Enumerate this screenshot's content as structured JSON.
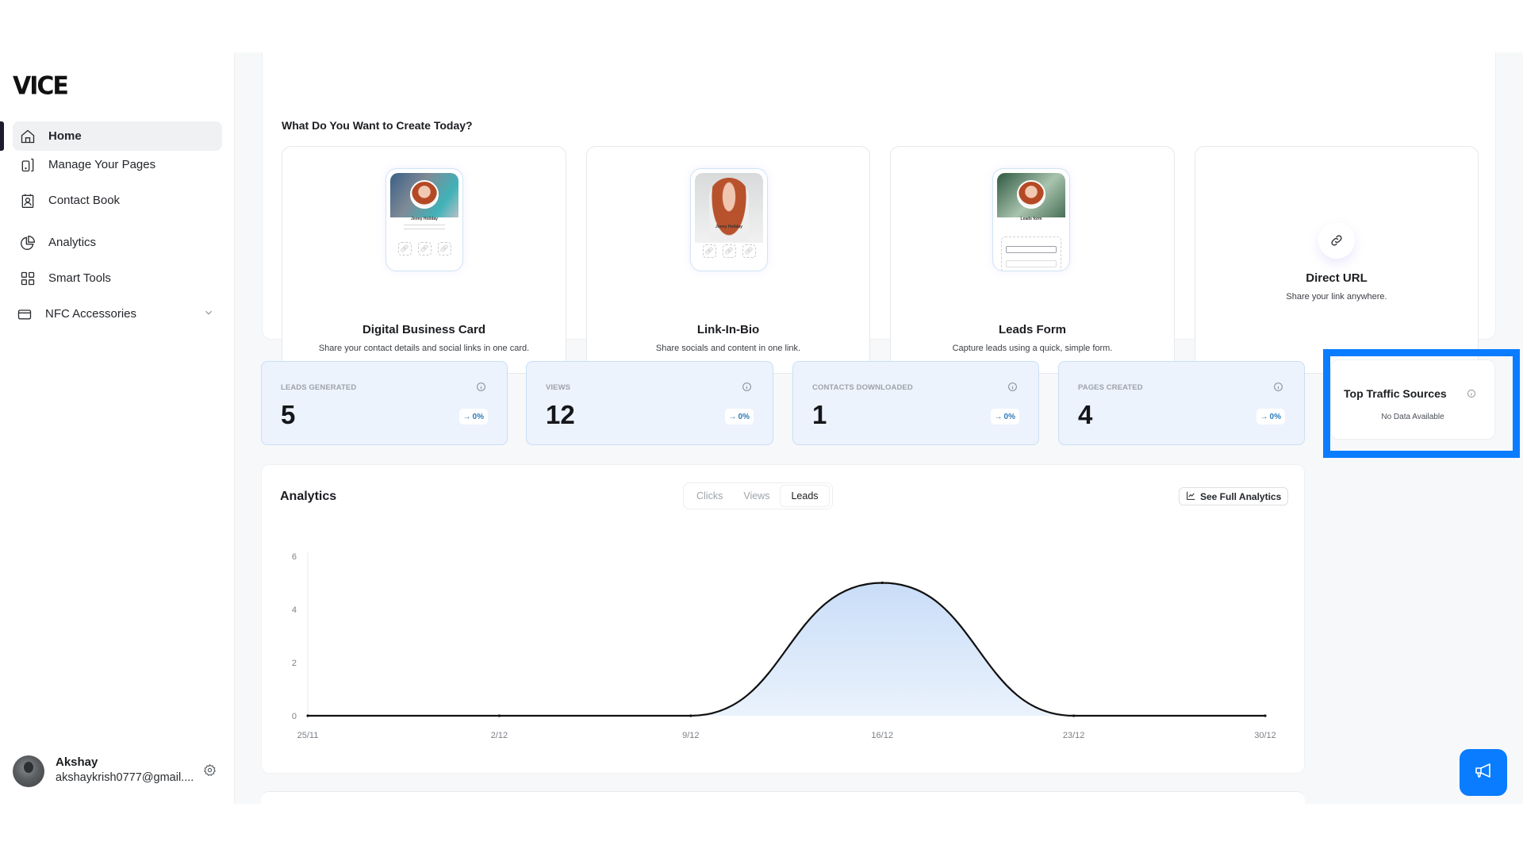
{
  "app": {
    "logo": "VICE"
  },
  "sidebar": {
    "items": [
      {
        "label": "Home",
        "icon": "home-icon",
        "active": true
      },
      {
        "label": "Manage Your Pages",
        "icon": "pages-icon"
      },
      {
        "label": "Contact Book",
        "icon": "contact-book-icon"
      },
      {
        "label": "Analytics",
        "icon": "pie-chart-icon"
      },
      {
        "label": "Smart Tools",
        "icon": "grid-icon"
      },
      {
        "label": "NFC Accessories",
        "icon": "card-icon",
        "expandable": true
      }
    ],
    "profile": {
      "name": "Akshay",
      "email": "akshaykrish0777@gmail...."
    }
  },
  "create": {
    "title": "What Do You Want to Create Today?",
    "cards": [
      {
        "title": "Digital Business Card",
        "desc": "Share your contact details and social links in one card.",
        "preview_name": "Jenny Holiday"
      },
      {
        "title": "Link-In-Bio",
        "desc": "Share socials and content in one link.",
        "preview_name": "Jenny Holiday"
      },
      {
        "title": "Leads Form",
        "desc": "Capture leads using a quick, simple form.",
        "preview_name": "Leads form"
      },
      {
        "title": "Direct URL",
        "desc": "Share your link anywhere."
      }
    ]
  },
  "stats": [
    {
      "label": "LEADS GENERATED",
      "value": "5",
      "change": "0%"
    },
    {
      "label": "VIEWS",
      "value": "12",
      "change": "0%"
    },
    {
      "label": "CONTACTS DOWNLOADED",
      "value": "1",
      "change": "0%"
    },
    {
      "label": "PAGES CREATED",
      "value": "4",
      "change": "0%"
    }
  ],
  "traffic": {
    "title": "Top Traffic Sources",
    "empty": "No Data Available"
  },
  "analytics": {
    "title": "Analytics",
    "tabs": [
      "Clicks",
      "Views",
      "Leads"
    ],
    "active_tab": "Leads",
    "full_button": "See Full Analytics"
  },
  "colors": {
    "accent": "#0a7cff",
    "stat_bg": "#ecf3fd",
    "area_fill": "#c9ddf8",
    "line": "#111111"
  },
  "chart_data": {
    "type": "area",
    "title": "Analytics",
    "series": [
      {
        "name": "Leads",
        "values": [
          0,
          0,
          0,
          5,
          0,
          0
        ]
      }
    ],
    "x": [
      "25/11",
      "2/12",
      "9/12",
      "16/12",
      "23/12",
      "30/12"
    ],
    "yticks": [
      0,
      2,
      4,
      6
    ],
    "ylim": [
      0,
      6
    ],
    "xlabel": "",
    "ylabel": "",
    "grid": false,
    "legend": "none"
  }
}
